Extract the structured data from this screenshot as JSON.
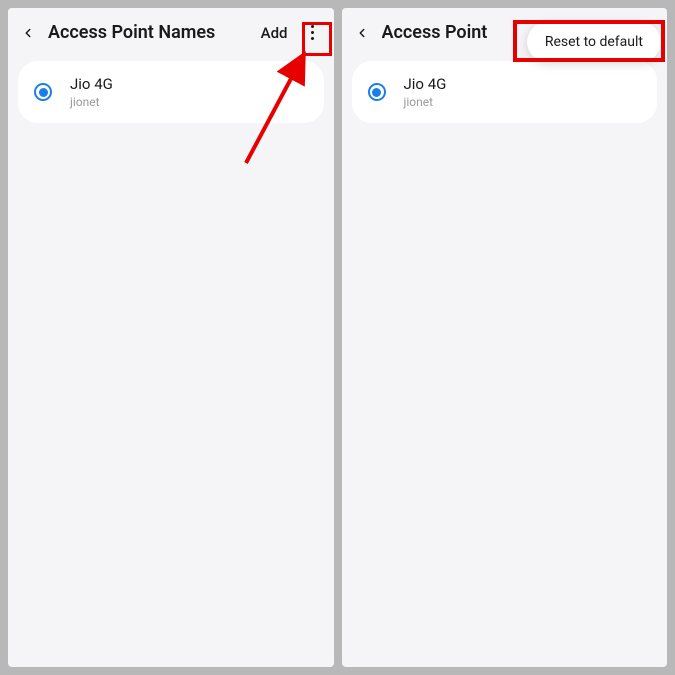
{
  "left": {
    "title": "Access Point Names",
    "add_label": "Add",
    "apn": {
      "name": "Jio 4G",
      "subtitle": "jionet"
    }
  },
  "right": {
    "title": "Access Point",
    "popup": {
      "reset": "Reset to default"
    },
    "apn": {
      "name": "Jio 4G",
      "subtitle": "jionet"
    }
  }
}
